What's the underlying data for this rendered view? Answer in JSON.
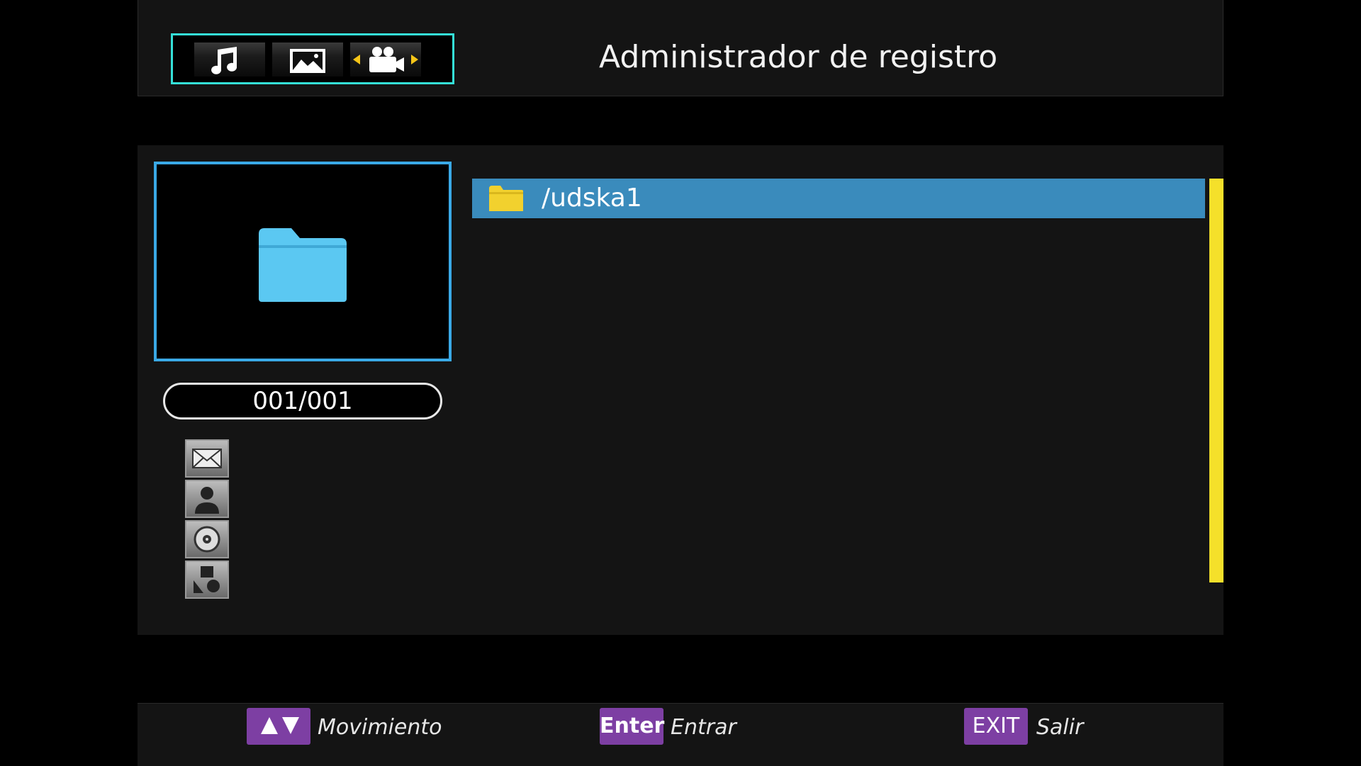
{
  "header": {
    "title": "Administrador de registro",
    "media_tabs": [
      {
        "icon": "music-note-icon"
      },
      {
        "icon": "picture-icon"
      },
      {
        "icon": "video-camera-icon"
      }
    ]
  },
  "preview": {
    "icon": "folder-icon",
    "page_counter": "001/001"
  },
  "sort_icons": [
    "envelope-icon",
    "person-icon",
    "disc-icon",
    "shapes-icon"
  ],
  "file_list": {
    "items": [
      {
        "name": "/udska1",
        "icon": "folder-icon"
      }
    ],
    "selected_index": 0
  },
  "footer": {
    "move_hint": "Movimiento",
    "enter_key": "Enter",
    "enter_hint": "Entrar",
    "exit_key": "EXIT",
    "exit_hint": "Salir"
  },
  "colors": {
    "accent_teal": "#35e0d8",
    "accent_blue": "#3aa9e6",
    "selection": "#3a8bbc",
    "scrollbar": "#f5e02a",
    "key_button": "#7d3fa3",
    "folder_yellow": "#f2d12e"
  }
}
